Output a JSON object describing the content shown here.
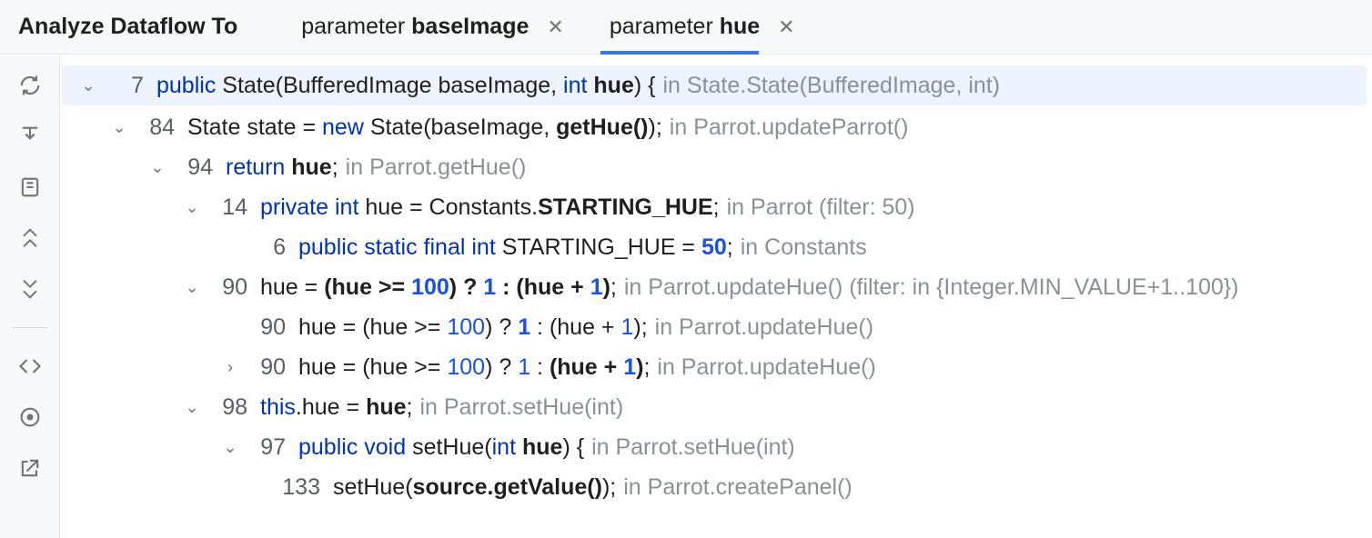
{
  "header": {
    "title": "Analyze Dataflow To",
    "tabs": [
      {
        "prefix": "parameter ",
        "bold": "baseImage",
        "active": false
      },
      {
        "prefix": "parameter ",
        "bold": "hue",
        "active": true
      }
    ]
  },
  "sidebar_icons": [
    "refresh",
    "import-down",
    "book",
    "chevron-up",
    "chevron-down",
    "code-angle",
    "radar",
    "external-link"
  ],
  "rows": [
    {
      "indent": 0,
      "arrow": "down",
      "selected": true,
      "line": "7",
      "tokens": [
        {
          "t": "public ",
          "c": "kw"
        },
        {
          "t": "State(BufferedImage baseImage, ",
          "c": ""
        },
        {
          "t": "int ",
          "c": "kw"
        },
        {
          "t": "hue",
          "c": "b"
        },
        {
          "t": ") {",
          "c": ""
        }
      ],
      "ctx": "in State.State(BufferedImage, int)"
    },
    {
      "indent": 1,
      "arrow": "down",
      "line": "84",
      "tokens": [
        {
          "t": "State state = ",
          "c": ""
        },
        {
          "t": "new ",
          "c": "kw"
        },
        {
          "t": "State(baseImage, ",
          "c": ""
        },
        {
          "t": "getHue()",
          "c": "b"
        },
        {
          "t": ");",
          "c": ""
        }
      ],
      "ctx": "in Parrot.updateParrot()"
    },
    {
      "indent": 2,
      "arrow": "down",
      "line": "94",
      "tokens": [
        {
          "t": "return ",
          "c": "kw"
        },
        {
          "t": "hue",
          "c": "b"
        },
        {
          "t": ";",
          "c": ""
        }
      ],
      "ctx": "in Parrot.getHue()"
    },
    {
      "indent": 3,
      "arrow": "down",
      "line": "14",
      "tokens": [
        {
          "t": "private int ",
          "c": "kw"
        },
        {
          "t": "hue = Constants.",
          "c": ""
        },
        {
          "t": "STARTING_HUE",
          "c": "b"
        },
        {
          "t": ";",
          "c": ""
        }
      ],
      "ctx": "in Parrot (filter: 50)"
    },
    {
      "indent": 4,
      "arrow": "blank",
      "line": "6",
      "tokens": [
        {
          "t": "public static final int ",
          "c": "kw"
        },
        {
          "t": "STARTING_HUE = ",
          "c": ""
        },
        {
          "t": "50",
          "c": "num b"
        },
        {
          "t": ";",
          "c": ""
        }
      ],
      "ctx": "in Constants"
    },
    {
      "indent": 3,
      "arrow": "down",
      "line": "90",
      "tokens": [
        {
          "t": "hue = ",
          "c": ""
        },
        {
          "t": "(hue >= ",
          "c": "b"
        },
        {
          "t": "100",
          "c": "num b"
        },
        {
          "t": ") ? ",
          "c": "b"
        },
        {
          "t": "1",
          "c": "num b"
        },
        {
          "t": " : (hue + ",
          "c": "b"
        },
        {
          "t": "1",
          "c": "num b"
        },
        {
          "t": ")",
          "c": "b"
        },
        {
          "t": ";",
          "c": ""
        }
      ],
      "ctx": "in Parrot.updateHue() (filter: in {Integer.MIN_VALUE+1..100})"
    },
    {
      "indent": 4,
      "arrow": "blank",
      "line": "90",
      "tokens": [
        {
          "t": "hue = (hue >= ",
          "c": ""
        },
        {
          "t": "100",
          "c": "num"
        },
        {
          "t": ") ? ",
          "c": ""
        },
        {
          "t": "1",
          "c": "num b"
        },
        {
          "t": " : (hue + ",
          "c": ""
        },
        {
          "t": "1",
          "c": "num"
        },
        {
          "t": ");",
          "c": ""
        }
      ],
      "ctx": "in Parrot.updateHue()"
    },
    {
      "indent": 4,
      "arrow": "right",
      "line": "90",
      "tokens": [
        {
          "t": "hue = (hue >= ",
          "c": ""
        },
        {
          "t": "100",
          "c": "num"
        },
        {
          "t": ") ? ",
          "c": ""
        },
        {
          "t": "1",
          "c": "num"
        },
        {
          "t": " : ",
          "c": ""
        },
        {
          "t": "(hue + ",
          "c": "b"
        },
        {
          "t": "1",
          "c": "num b"
        },
        {
          "t": ")",
          "c": "b"
        },
        {
          "t": ";",
          "c": ""
        }
      ],
      "ctx": "in Parrot.updateHue()"
    },
    {
      "indent": 3,
      "arrow": "down",
      "line": "98",
      "tokens": [
        {
          "t": "this",
          "c": "kw"
        },
        {
          "t": ".hue = ",
          "c": ""
        },
        {
          "t": "hue",
          "c": "b"
        },
        {
          "t": ";",
          "c": ""
        }
      ],
      "ctx": "in Parrot.setHue(int)"
    },
    {
      "indent": 4,
      "arrow": "down",
      "line": "97",
      "tokens": [
        {
          "t": "public void ",
          "c": "kw"
        },
        {
          "t": "setHue(",
          "c": ""
        },
        {
          "t": "int ",
          "c": "kw"
        },
        {
          "t": "hue",
          "c": "b"
        },
        {
          "t": ") {",
          "c": ""
        }
      ],
      "ctx": "in Parrot.setHue(int)"
    },
    {
      "indent": 5,
      "arrow": "blank",
      "line": "133",
      "tokens": [
        {
          "t": "setHue(",
          "c": ""
        },
        {
          "t": "source.getValue()",
          "c": "b"
        },
        {
          "t": ");",
          "c": ""
        }
      ],
      "ctx": "in Parrot.createPanel()"
    }
  ]
}
